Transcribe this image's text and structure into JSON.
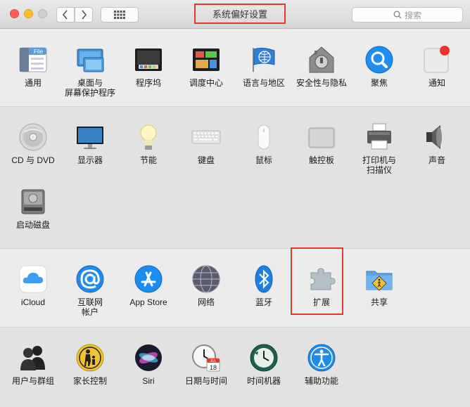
{
  "window": {
    "title": "系统偏好设置",
    "search_placeholder": "搜索"
  },
  "sections": [
    {
      "panes": [
        {
          "label": "通用",
          "icon": "general-icon"
        },
        {
          "label": "桌面与\n屏幕保护程序",
          "icon": "desktop-screensaver-icon"
        },
        {
          "label": "程序坞",
          "icon": "dock-icon"
        },
        {
          "label": "调度中心",
          "icon": "mission-control-icon"
        },
        {
          "label": "语言与地区",
          "icon": "language-region-icon"
        },
        {
          "label": "安全性与隐私",
          "icon": "security-privacy-icon"
        },
        {
          "label": "聚焦",
          "icon": "spotlight-icon"
        },
        {
          "label": "通知",
          "icon": "notifications-icon"
        }
      ]
    },
    {
      "panes": [
        {
          "label": "CD 与 DVD",
          "icon": "cd-dvd-icon"
        },
        {
          "label": "显示器",
          "icon": "displays-icon"
        },
        {
          "label": "节能",
          "icon": "energy-saver-icon"
        },
        {
          "label": "键盘",
          "icon": "keyboard-icon"
        },
        {
          "label": "鼠标",
          "icon": "mouse-icon"
        },
        {
          "label": "触控板",
          "icon": "trackpad-icon"
        },
        {
          "label": "打印机与\n扫描仪",
          "icon": "printers-scanners-icon"
        },
        {
          "label": "声音",
          "icon": "sound-icon"
        },
        {
          "label": "启动磁盘",
          "icon": "startup-disk-icon"
        }
      ]
    },
    {
      "panes": [
        {
          "label": "iCloud",
          "icon": "icloud-icon"
        },
        {
          "label": "互联网\n帐户",
          "icon": "internet-accounts-icon"
        },
        {
          "label": "App Store",
          "icon": "app-store-icon"
        },
        {
          "label": "网络",
          "icon": "network-icon"
        },
        {
          "label": "蓝牙",
          "icon": "bluetooth-icon"
        },
        {
          "label": "扩展",
          "icon": "extensions-icon"
        },
        {
          "label": "共享",
          "icon": "sharing-icon"
        }
      ]
    },
    {
      "panes": [
        {
          "label": "用户与群组",
          "icon": "users-groups-icon"
        },
        {
          "label": "家长控制",
          "icon": "parental-controls-icon"
        },
        {
          "label": "Siri",
          "icon": "siri-icon"
        },
        {
          "label": "日期与时间",
          "icon": "date-time-icon"
        },
        {
          "label": "时间机器",
          "icon": "time-machine-icon"
        },
        {
          "label": "辅助功能",
          "icon": "accessibility-icon"
        }
      ]
    }
  ],
  "calendar_month": "JUL",
  "calendar_day": "18",
  "general_icon_text": "File"
}
